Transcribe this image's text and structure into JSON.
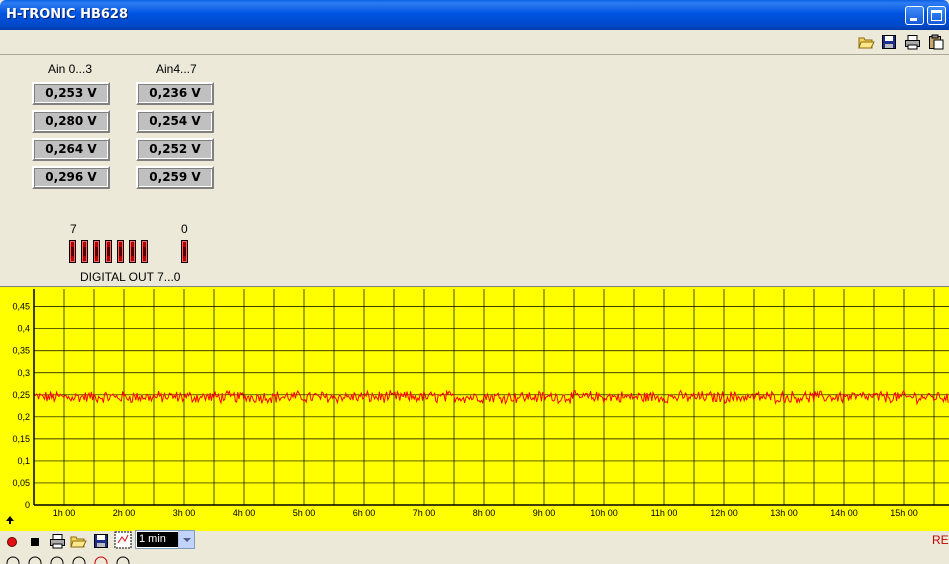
{
  "window": {
    "title": "H-TRONIC HB628"
  },
  "toolbar_icons": [
    "open-folder-icon",
    "save-disk-icon",
    "print-icon",
    "clipboard-icon"
  ],
  "analog_inputs": {
    "group1_label": "Ain 0...3",
    "group2_label": "Ain4...7",
    "group1_values": [
      "0,253  V",
      "0,280  V",
      "0,264  V",
      "0,296  V"
    ],
    "group2_values": [
      "0,236  V",
      "0,254  V",
      "0,252  V",
      "0,259  V"
    ]
  },
  "digital_out": {
    "label": "DIGITAL OUT 7...0",
    "high_bit_label": "7",
    "low_bit_label": "0",
    "bits": [
      0,
      0,
      0,
      0,
      0,
      0,
      0,
      0
    ]
  },
  "chart_data": {
    "type": "line",
    "ylim": [
      0,
      0.49
    ],
    "y_ticks": [
      0,
      0.05,
      0.1,
      0.15,
      0.2,
      0.25,
      0.3,
      0.35,
      0.4,
      0.45
    ],
    "y_tick_labels": [
      "0",
      "0,05",
      "0,1",
      "0,15",
      "0,2",
      "0,25",
      "0,3",
      "0,35",
      "0,4",
      "0,45"
    ],
    "x_tick_labels": [
      "1h 00",
      "2h 00",
      "3h 00",
      "4h 00",
      "5h 00",
      "6h 00",
      "7h 00",
      "8h 00",
      "9h 00",
      "10h 00",
      "11h 00",
      "12h 00",
      "13h 00",
      "14h 00",
      "15h 00"
    ],
    "x_range_hours": [
      0.5,
      15.75
    ],
    "grid": true,
    "background": "#ffff00",
    "series": [
      {
        "color": "#ff0000",
        "mean": 0.245,
        "noise": 0.012
      }
    ]
  },
  "bottom_toolbar": {
    "interval_value": "1 min",
    "status_text": "RE",
    "icons": [
      "record-icon",
      "stop-icon",
      "print-icon",
      "open-folder-icon",
      "save-disk-icon",
      "clear-chart-icon"
    ]
  },
  "colors": {
    "titlebar": "#0054e3",
    "window_bg": "#ece9d8",
    "chart_bg": "#ffff00",
    "trace": "#ff0000",
    "led": "#aa0000"
  }
}
